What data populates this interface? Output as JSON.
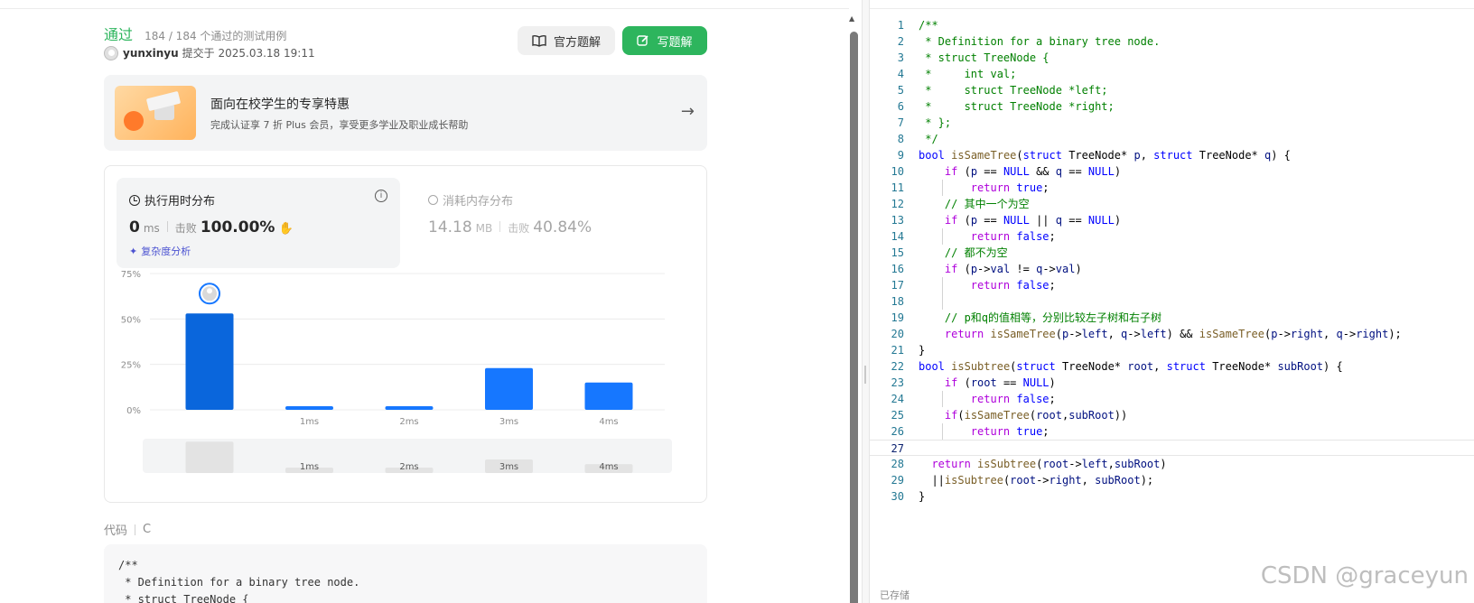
{
  "submission": {
    "status": "通过",
    "count": "184 / 184 个通过的测试用例",
    "user": "yunxinyu",
    "submitted": "提交于 2025.03.18 19:11",
    "official_solution": "官方题解",
    "write_solution": "写题解"
  },
  "promo": {
    "title": "面向在校学生的专享特惠",
    "subtitle": "完成认证享 7 折 Plus 会员，享受更多学业及职业成长帮助"
  },
  "runtime": {
    "title": "执行用时分布",
    "value": "0",
    "unit": "ms",
    "beat_label": "击败",
    "beat": "100.00%",
    "complexity": "复杂度分析"
  },
  "memory": {
    "title": "消耗内存分布",
    "value": "14.18",
    "unit": "MB",
    "beat_label": "击败",
    "beat": "40.84%"
  },
  "chart_data": {
    "type": "bar",
    "categories": [
      "",
      "1ms",
      "2ms",
      "3ms",
      "4ms"
    ],
    "values": [
      53,
      2,
      2,
      23,
      15
    ],
    "yticks": [
      "75%",
      "50%",
      "25%",
      "0%"
    ],
    "ylim": [
      0,
      75
    ],
    "highlight_index": 0,
    "colors": {
      "highlight": "#0a66dc",
      "bar": "#1677ff",
      "grid": "#ececec",
      "nav_bar": "#e3e3e3"
    }
  },
  "code_section": {
    "label": "代码",
    "lang": "C",
    "preview": "/**\n * Definition for a binary tree node.\n * struct TreeNode {"
  },
  "editor": {
    "status": "已存储",
    "watermark": "CSDN @graceyun",
    "active_line": 27
  },
  "colors": {
    "accent_green": "#2db55d",
    "link_purple": "#4b52d1",
    "line_number": "#237893"
  }
}
